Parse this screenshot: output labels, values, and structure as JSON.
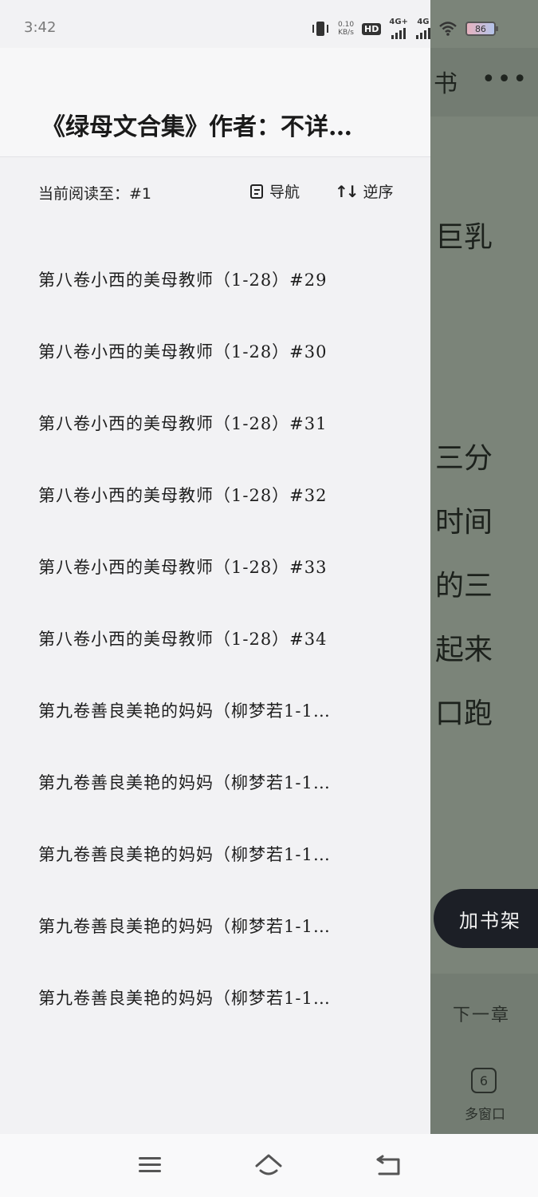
{
  "status_bar": {
    "time": "3:42",
    "net_speed_value": "0.10",
    "net_speed_unit": "KB/s",
    "hd_label": "HD",
    "sim1_label": "4G+",
    "sim2_label": "4G",
    "battery": "86"
  },
  "reader": {
    "title_fragment": "书",
    "more_label": "•••",
    "text_lines": [
      "巨乳",
      "三分",
      "时间",
      "的三",
      "起来",
      "口跑"
    ],
    "add_shelf_label": "加书架",
    "next_chapter_label": "下一章",
    "window_count": "6",
    "window_label": "多窗口"
  },
  "drawer": {
    "book_title": "《绿母文合集》作者：不详…",
    "progress_label": "当前阅读至：#1",
    "nav_label": "导航",
    "sort_label": "逆序",
    "chapters": [
      "第八卷小西的美母教师（1-28）#29",
      "第八卷小西的美母教师（1-28）#30",
      "第八卷小西的美母教师（1-28）#31",
      "第八卷小西的美母教师（1-28）#32",
      "第八卷小西的美母教师（1-28）#33",
      "第八卷小西的美母教师（1-28）#34",
      "第九卷善良美艳的妈妈（柳梦若1-1…",
      "第九卷善良美艳的妈妈（柳梦若1-1…",
      "第九卷善良美艳的妈妈（柳梦若1-1…",
      "第九卷善良美艳的妈妈（柳梦若1-1…",
      "第九卷善良美艳的妈妈（柳梦若1-1…"
    ]
  },
  "icons": {
    "nav": "document-list-icon",
    "sort": "sort-arrows-icon",
    "menu": "menu-icon",
    "home": "home-icon",
    "back": "back-icon"
  }
}
